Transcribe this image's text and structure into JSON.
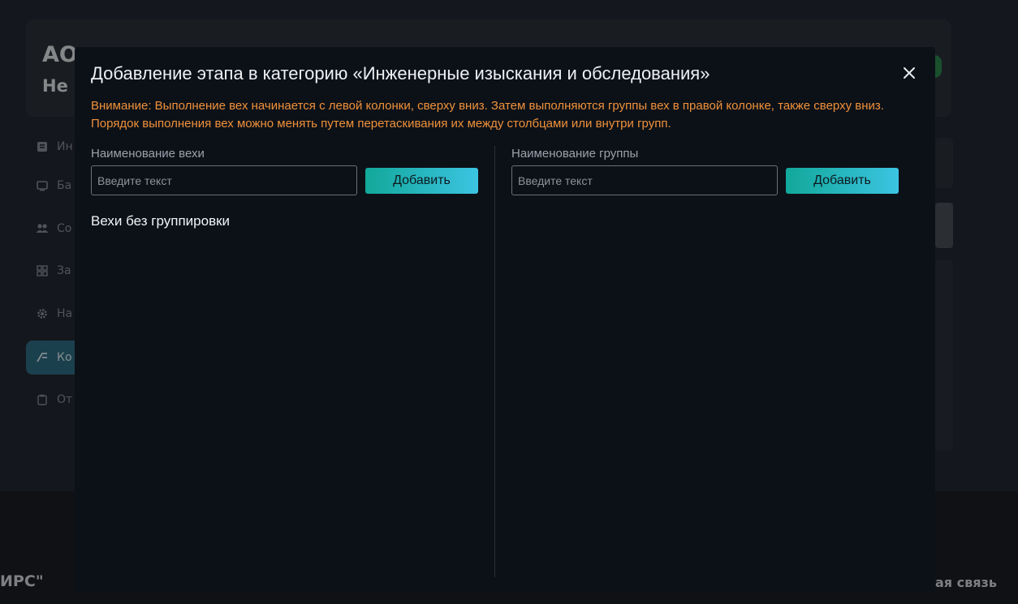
{
  "background": {
    "title": "АО",
    "subtitle": "Не",
    "sidebar": {
      "items": [
        {
          "label": "Ин",
          "icon": "info-square-icon"
        },
        {
          "label": "Ба",
          "icon": "monitor-icon"
        },
        {
          "label": "Со",
          "icon": "users-icon"
        },
        {
          "label": "За",
          "icon": "grid-icon"
        },
        {
          "label": "На",
          "icon": "gear-icon"
        },
        {
          "label": "Ко",
          "icon": "flow-icon",
          "active": true
        },
        {
          "label": "От",
          "icon": "clipboard-icon"
        }
      ]
    },
    "footer": {
      "left_text": "ИРС\"",
      "right_text": "ая связь"
    }
  },
  "modal": {
    "title": "Добавление этапа в категорию «Инженерные изыскания и обследования»",
    "close_icon": "close-icon",
    "warning": "Внимание: Выполнение вех начинается с левой колонки, сверху вниз. Затем выполняются группы вех в правой колонке, также сверху вниз. Порядок выполнения вех можно менять путем перетаскивания их между столбцами или внутри групп.",
    "left": {
      "label": "Наименование вехи",
      "placeholder": "Введите текст",
      "value": "",
      "button": "Добавить",
      "section_title": "Вехи без группировки"
    },
    "right": {
      "label": "Наименование группы",
      "placeholder": "Введите текст",
      "value": "",
      "button": "Добавить"
    },
    "colors": {
      "warning": "#f0913a",
      "accent_start": "#12a89a",
      "accent_end": "#3cc4e2",
      "modal_bg": "#0c1118"
    }
  }
}
